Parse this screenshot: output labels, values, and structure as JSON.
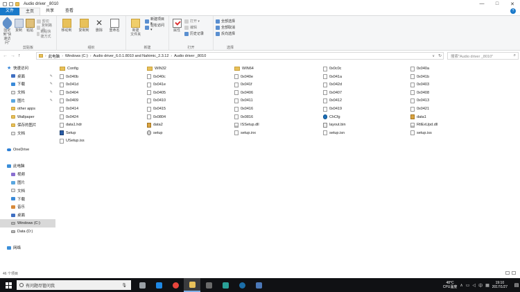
{
  "window": {
    "title": "Audio driver _8010",
    "controls": [
      "—",
      "□",
      "✕"
    ]
  },
  "ribbon_tabs": [
    "文件",
    "主页",
    "共享",
    "查看"
  ],
  "ribbon": {
    "clipboard": {
      "label": "剪贴板",
      "pin_label": "固定到\"快速访问\"",
      "copy_label": "复制",
      "paste_label": "粘贴",
      "cut": "剪切",
      "copy_path": "复制路径",
      "paste_shortcut": "粘贴快捷方式"
    },
    "organize": {
      "label": "组织",
      "move_to": "移动到",
      "copy_to": "复制到",
      "delete": "删除",
      "rename": "重命名"
    },
    "new": {
      "label": "新建",
      "new_folder": "新建\n文件夹",
      "new_item": "新建项目 ▾",
      "easy_access": "轻松访问 ▾"
    },
    "open": {
      "label": "打开",
      "properties": "属性",
      "open": "打开 ▾",
      "edit": "编辑",
      "history": "历史记录"
    },
    "select": {
      "label": "选择",
      "select_all": "全部选择",
      "select_none": "全部取消",
      "invert": "反向选择"
    }
  },
  "nav_buttons": [
    "←",
    "→",
    "↑"
  ],
  "address": {
    "segments": [
      "此电脑",
      "Windows (C:)",
      "Audio driver_6.0.1.8010 and Nahimic_2.3.12",
      "Audio driver _8010"
    ],
    "separator": "›",
    "dropdown": "∨",
    "refresh": "↻"
  },
  "search": {
    "placeholder": "搜索\"Audio driver _8010\"",
    "icon": "search-icon"
  },
  "nav_pane": {
    "items": [
      {
        "label": "快速访问",
        "icon": "star-icon",
        "indent": 0
      },
      {
        "label": "桌面",
        "icon": "desktop-icon",
        "indent": 1,
        "pinned": true
      },
      {
        "label": "下载",
        "icon": "download-icon",
        "indent": 1,
        "pinned": true
      },
      {
        "label": "文档",
        "icon": "documents-icon",
        "indent": 1,
        "pinned": true
      },
      {
        "label": "图片",
        "icon": "pictures-icon",
        "indent": 1,
        "pinned": true
      },
      {
        "label": "other apps",
        "icon": "folder-icon",
        "indent": 1
      },
      {
        "label": "Wallpaper",
        "icon": "folder-icon",
        "indent": 1
      },
      {
        "label": "保存的图片",
        "icon": "folder-icon",
        "indent": 1
      },
      {
        "label": "文档",
        "icon": "documents-icon",
        "indent": 1
      },
      {
        "label": "",
        "icon": "",
        "indent": 0
      },
      {
        "label": "OneDrive",
        "icon": "onedrive-icon",
        "indent": 0
      },
      {
        "label": "",
        "icon": "",
        "indent": 0
      },
      {
        "label": "此电脑",
        "icon": "computer-icon",
        "indent": 0
      },
      {
        "label": "视频",
        "icon": "videos-icon",
        "indent": 1
      },
      {
        "label": "图片",
        "icon": "pictures-icon",
        "indent": 1
      },
      {
        "label": "文档",
        "icon": "documents-icon",
        "indent": 1
      },
      {
        "label": "下载",
        "icon": "download-icon",
        "indent": 1
      },
      {
        "label": "音乐",
        "icon": "music-icon",
        "indent": 1
      },
      {
        "label": "桌面",
        "icon": "desktop-icon",
        "indent": 1
      },
      {
        "label": "Windows (C:)",
        "icon": "drive-icon",
        "indent": 1,
        "selected": true
      },
      {
        "label": "Data (D:)",
        "icon": "drive-icon",
        "indent": 1
      },
      {
        "label": "",
        "icon": "",
        "indent": 0
      },
      {
        "label": "网络",
        "icon": "network-icon",
        "indent": 0
      }
    ]
  },
  "files": [
    [
      "Config",
      "WIN32",
      "WIN64",
      "0x0c0c",
      "0x040a"
    ],
    [
      "0x040b",
      "0x040c",
      "0x040e",
      "0x041a",
      "0x041b"
    ],
    [
      "0x041d",
      "0x041e",
      "0x041f",
      "0x042d",
      "0x0403"
    ],
    [
      "0x0404",
      "0x0405",
      "0x0406",
      "0x0407",
      "0x0408"
    ],
    [
      "0x0409",
      "0x0410",
      "0x0411",
      "0x0412",
      "0x0413"
    ],
    [
      "0x0414",
      "0x0415",
      "0x0416",
      "0x0419",
      "0x0421"
    ],
    [
      "0x0424",
      "0x0804",
      "0x0816",
      "ChCfg",
      "data1"
    ],
    [
      "data1.hdr",
      "data2",
      "ISSetup.dll",
      "layout.bin",
      "RtlExUpd.dll"
    ],
    [
      "Setup",
      "setup",
      "setup.inx",
      "setup.isn",
      "setup.iss"
    ],
    [
      "USetup.iss",
      "",
      "",
      "",
      ""
    ]
  ],
  "status": {
    "count": "46 个项目"
  },
  "taskbar": {
    "search_placeholder": "有问题尽管问我",
    "weather_temp": "48°C",
    "weather_label": "CPU温度",
    "ime": "中",
    "time": "19:10",
    "date": "2017/1/27",
    "apps": [
      {
        "name": "task-view-icon",
        "color": "#9aa0a6"
      },
      {
        "name": "edge-icon",
        "color": "#1e88e5"
      },
      {
        "name": "chrome-icon",
        "color": "#e8453c"
      },
      {
        "name": "file-explorer-icon",
        "color": "#e8c15a",
        "active": true
      },
      {
        "name": "store-icon",
        "color": "#6a6a6a"
      },
      {
        "name": "app-icon",
        "color": "#2aa198"
      },
      {
        "name": "steam-icon",
        "color": "#1b6ea8"
      },
      {
        "name": "app2-icon",
        "color": "#4b78b8"
      }
    ]
  },
  "colors": {
    "accent": "#1979ca",
    "selection": "#cce8ff",
    "taskbar": "#101114"
  }
}
